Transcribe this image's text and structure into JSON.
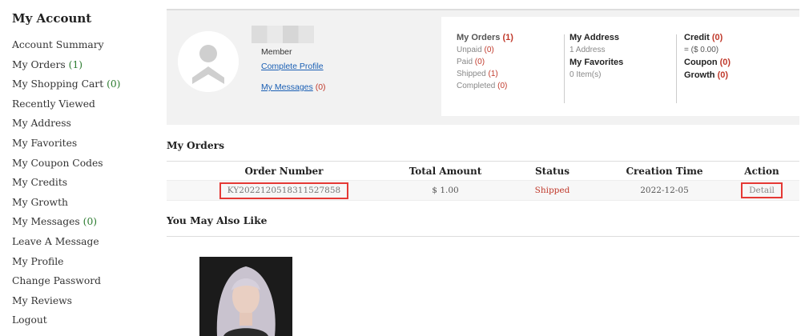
{
  "sidebar": {
    "title": "My Account",
    "items": [
      {
        "label": "Account Summary",
        "count": ""
      },
      {
        "label": "My Orders",
        "count": "(1)"
      },
      {
        "label": "My Shopping Cart",
        "count": "(0)"
      },
      {
        "label": "Recently Viewed",
        "count": ""
      },
      {
        "label": "My Address",
        "count": ""
      },
      {
        "label": "My Favorites",
        "count": ""
      },
      {
        "label": "My Coupon Codes",
        "count": ""
      },
      {
        "label": "My Credits",
        "count": ""
      },
      {
        "label": "My Growth",
        "count": ""
      },
      {
        "label": "My Messages",
        "count": "(0)"
      },
      {
        "label": "Leave A Message",
        "count": ""
      },
      {
        "label": "My Profile",
        "count": ""
      },
      {
        "label": "Change Password",
        "count": ""
      },
      {
        "label": "My Reviews",
        "count": ""
      },
      {
        "label": "Logout",
        "count": ""
      }
    ]
  },
  "profile": {
    "member_label": "Member",
    "complete_profile": "Complete Profile",
    "messages_label": "My Messages",
    "messages_count": "(0)"
  },
  "stats": {
    "orders": {
      "label": "My Orders",
      "count": "(1)",
      "rows": [
        {
          "label": "Unpaid",
          "count": "(0)"
        },
        {
          "label": "Paid",
          "count": "(0)"
        },
        {
          "label": "Shipped",
          "count": "(1)"
        },
        {
          "label": "Completed",
          "count": "(0)"
        }
      ]
    },
    "address": {
      "label": "My Address",
      "sub": "1 Address"
    },
    "favorites": {
      "label": "My Favorites",
      "sub": "0 Item(s)"
    },
    "credit": {
      "label": "Credit",
      "count": "(0)",
      "sub": "= ($ 0.00)"
    },
    "coupon": {
      "label": "Coupon",
      "count": "(0)"
    },
    "growth": {
      "label": "Growth",
      "count": "(0)"
    }
  },
  "orders": {
    "heading": "My Orders",
    "columns": [
      "Order Number",
      "Total Amount",
      "Status",
      "Creation Time",
      "Action"
    ],
    "rows": [
      {
        "order_number": "KY20221205183115278​58",
        "total": "$ 1.00",
        "status": "Shipped",
        "created": "2022-12-05",
        "action": "Detail"
      }
    ]
  },
  "recommendations": {
    "heading": "You May Also Like"
  },
  "colors": {
    "accent_red": "#e53935",
    "link_blue": "#1a5fb4",
    "count_green": "#2e7d32"
  }
}
